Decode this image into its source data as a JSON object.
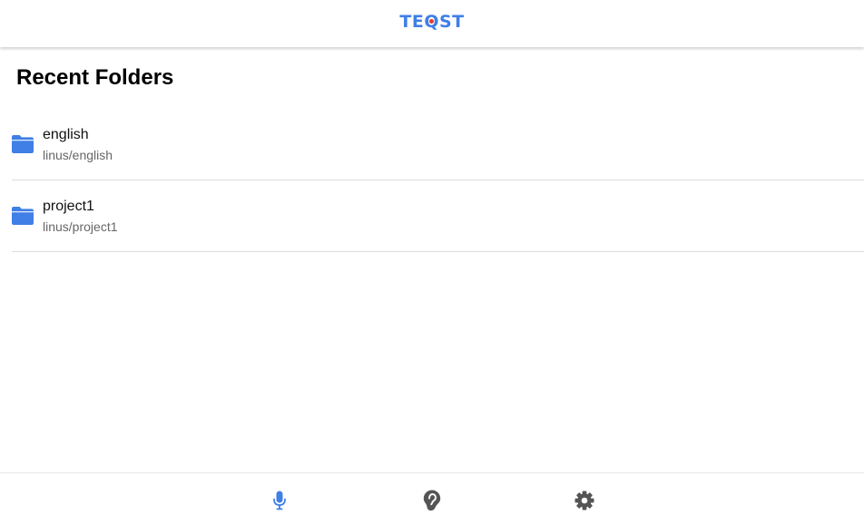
{
  "header": {
    "logo_prefix": "TE",
    "logo_q": "Q",
    "logo_suffix": "ST",
    "brand_color": "#3f7fe6",
    "logo_dot_color": "#e53935"
  },
  "main": {
    "title": "Recent Folders",
    "folders": [
      {
        "name": "english",
        "path": "linus/english",
        "icon": "folder-icon"
      },
      {
        "name": "project1",
        "path": "linus/project1",
        "icon": "folder-icon"
      }
    ],
    "folder_icon_color": "#3f7fe6"
  },
  "bottom_nav": {
    "items": [
      {
        "name": "record",
        "icon": "microphone-icon",
        "active": true
      },
      {
        "name": "listen",
        "icon": "ear-icon",
        "active": false
      },
      {
        "name": "settings",
        "icon": "gear-icon",
        "active": false
      }
    ],
    "active_color": "#3f7fe6",
    "inactive_color": "#555555"
  }
}
